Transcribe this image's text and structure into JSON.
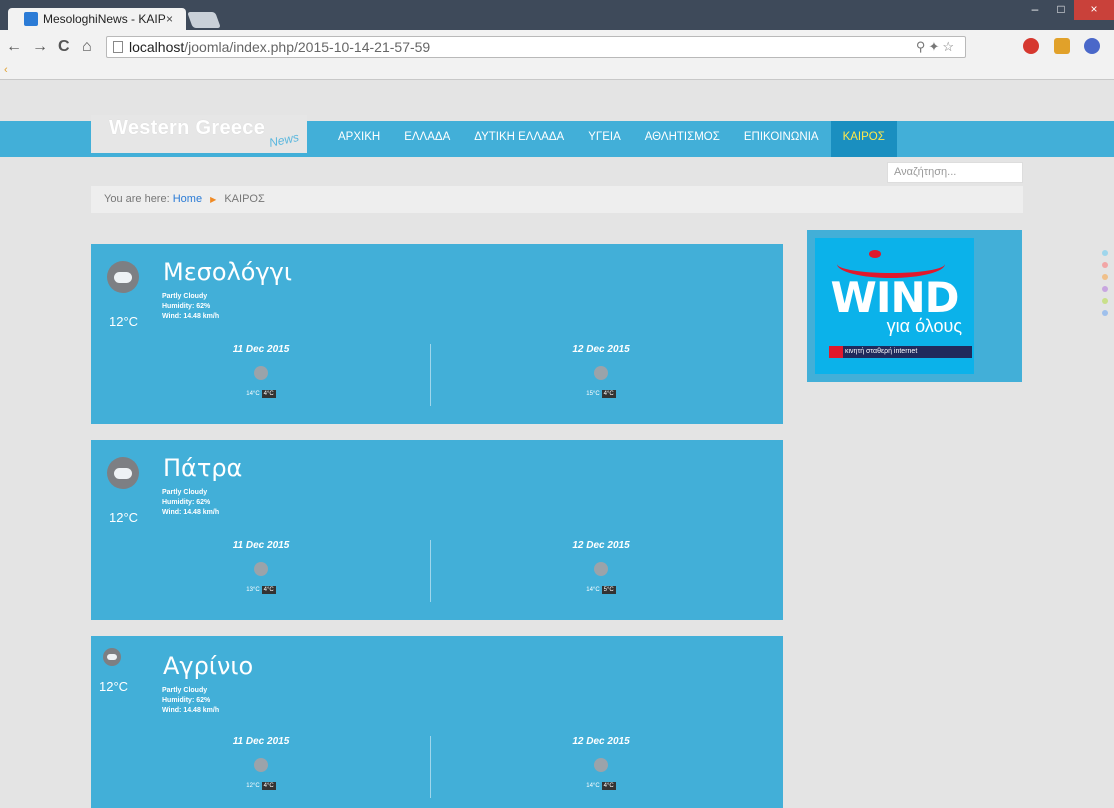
{
  "browser": {
    "tab_title": "MesologhiNews - ΚΑΙΡΟΣ",
    "tab_close": "×",
    "url_host": "localhost",
    "url_path": "/joomla/index.php/2015-10-14-21-57-59",
    "back_icon": "←",
    "forward_icon": "→",
    "reload_icon": "C",
    "home_icon": "⌂",
    "min_label": "–",
    "max_label": "□",
    "close_label": "×",
    "load_mark": "‹",
    "addr_icons": "⚲✦☆"
  },
  "site": {
    "logo_text": "Western Greece",
    "logo_sub": "News",
    "menu": [
      "ΑΡΧΙΚΗ",
      "ΕΛΛΑΔΑ",
      "ΔΥΤΙΚΗ ΕΛΛΑΔΑ",
      "ΥΓΕΙΑ",
      "ΑΘΛΗΤΙΣΜΟΣ",
      "ΕΠΙΚΟΙΝΩΝΙΑ",
      "ΚΑΙΡΟΣ"
    ],
    "active_menu": "ΚΑΙΡΟΣ",
    "search_placeholder": "Αναζήτηση...",
    "breadcrumb_prefix": "You are here:",
    "breadcrumb_home": "Home",
    "breadcrumb_sep": "▶",
    "breadcrumb_current": "ΚΑΙΡΟΣ"
  },
  "weather": [
    {
      "city": "Μεσολόγγι",
      "temp": "12°C",
      "condition": "Partly Cloudy",
      "humidity": "Humidity: 62%",
      "wind": "Wind: 14.48 km/h",
      "forecast": [
        {
          "date": "11 Dec 2015",
          "high": "14°C",
          "low": "4°C"
        },
        {
          "date": "12 Dec 2015",
          "high": "15°C",
          "low": "4°C"
        }
      ]
    },
    {
      "city": "Πάτρα",
      "temp": "12°C",
      "condition": "Partly Cloudy",
      "humidity": "Humidity: 62%",
      "wind": "Wind: 14.48 km/h",
      "forecast": [
        {
          "date": "11 Dec 2015",
          "high": "13°C",
          "low": "4°C"
        },
        {
          "date": "12 Dec 2015",
          "high": "14°C",
          "low": "5°C"
        }
      ]
    },
    {
      "city": "Αγρίνιο",
      "temp": "12°C",
      "condition": "Partly Cloudy",
      "humidity": "Humidity: 62%",
      "wind": "Wind: 14.48 km/h",
      "forecast": [
        {
          "date": "11 Dec 2015",
          "high": "12°C",
          "low": "4°C"
        },
        {
          "date": "12 Dec 2015",
          "high": "14°C",
          "low": "4°C"
        }
      ]
    }
  ],
  "ad": {
    "brand": "WIND",
    "slogan": "για όλους",
    "strip": "κινητή σταθερή internet"
  },
  "colors": {
    "site_blue": "#42afd8",
    "active_menu_text": "#ffe94a"
  }
}
